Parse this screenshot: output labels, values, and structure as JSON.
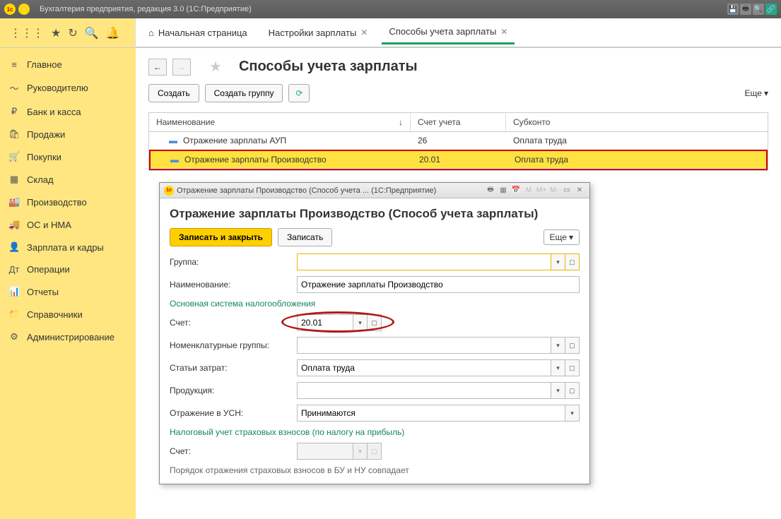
{
  "titlebar": {
    "app_title": "Бухгалтерия предприятия, редакция 3.0  (1С:Предприятие)"
  },
  "tabs": {
    "home": "Начальная страница",
    "t1": "Настройки зарплаты",
    "t2": "Способы учета зарплаты"
  },
  "sidebar": {
    "items": [
      {
        "icon": "≡",
        "label": "Главное"
      },
      {
        "icon": "〜",
        "label": "Руководителю"
      },
      {
        "icon": "₽",
        "label": "Банк и касса"
      },
      {
        "icon": "🛍",
        "label": "Продажи"
      },
      {
        "icon": "🛒",
        "label": "Покупки"
      },
      {
        "icon": "▦",
        "label": "Склад"
      },
      {
        "icon": "🏭",
        "label": "Производство"
      },
      {
        "icon": "🚚",
        "label": "ОС и НМА"
      },
      {
        "icon": "👤",
        "label": "Зарплата и кадры"
      },
      {
        "icon": "Дт",
        "label": "Операции"
      },
      {
        "icon": "📊",
        "label": "Отчеты"
      },
      {
        "icon": "📁",
        "label": "Справочники"
      },
      {
        "icon": "⚙",
        "label": "Администрирование"
      }
    ]
  },
  "page": {
    "title": "Способы учета зарплаты",
    "btn_create": "Создать",
    "btn_create_group": "Создать группу",
    "more": "Еще"
  },
  "grid": {
    "cols": {
      "c1": "Наименование",
      "c2": "Счет учета",
      "c3": "Субконто"
    },
    "rows": [
      {
        "name": "Отражение зарплаты АУП",
        "acct": "26",
        "sub": "Оплата труда"
      },
      {
        "name": "Отражение зарплаты Производство",
        "acct": "20.01",
        "sub": "Оплата труда"
      }
    ]
  },
  "modal": {
    "win_title": "Отражение зарплаты Производство (Способ учета ...  (1С:Предприятие)",
    "heading": "Отражение зарплаты Производство (Способ учета зарплаты)",
    "btn_save_close": "Записать и закрыть",
    "btn_save": "Записать",
    "btn_more": "Еще",
    "lbl_group": "Группа:",
    "val_group": "",
    "lbl_name": "Наименование:",
    "val_name": "Отражение зарплаты Производство",
    "section1": "Основная система налогообложения",
    "lbl_acct": "Счет:",
    "val_acct": "20.01",
    "lbl_nomgroups": "Номенклатурные группы:",
    "val_nomgroups": "",
    "lbl_cost": "Статьи затрат:",
    "val_cost": "Оплата труда",
    "lbl_prod": "Продукция:",
    "val_prod": "",
    "lbl_usn": "Отражение в УСН:",
    "val_usn": "Принимаются",
    "section2": "Налоговый учет страховых взносов (по налогу на прибыль)",
    "lbl_acct2": "Счет:",
    "val_acct2": "",
    "note": "Порядок отражения страховых взносов в БУ и НУ совпадает"
  }
}
